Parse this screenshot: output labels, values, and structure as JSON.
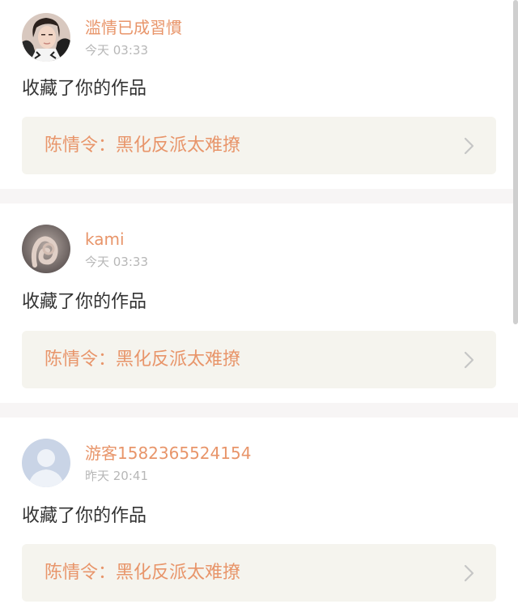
{
  "notifications": [
    {
      "username": "滥情已成習慣",
      "timestamp": "今天 03:33",
      "action": "收藏了你的作品",
      "work_title": "陈情令：黑化反派太难撩",
      "avatar_icon": "avatar-photo-woman-icon"
    },
    {
      "username": "kami",
      "timestamp": "今天 03:33",
      "action": "收藏了你的作品",
      "work_title": "陈情令：黑化反派太难撩",
      "avatar_icon": "avatar-photo-hand-icon"
    },
    {
      "username": "游客1582365524154",
      "timestamp": "昨天 20:41",
      "action": "收藏了你的作品",
      "work_title": "陈情令：黑化反派太难撩",
      "avatar_icon": "avatar-default-person-icon"
    }
  ],
  "colors": {
    "accent": "#e8956a",
    "timestamp": "#b7b7b7",
    "text": "#333333",
    "card_link_bg": "#f5f4ee",
    "divider": "#f7f5f5"
  }
}
